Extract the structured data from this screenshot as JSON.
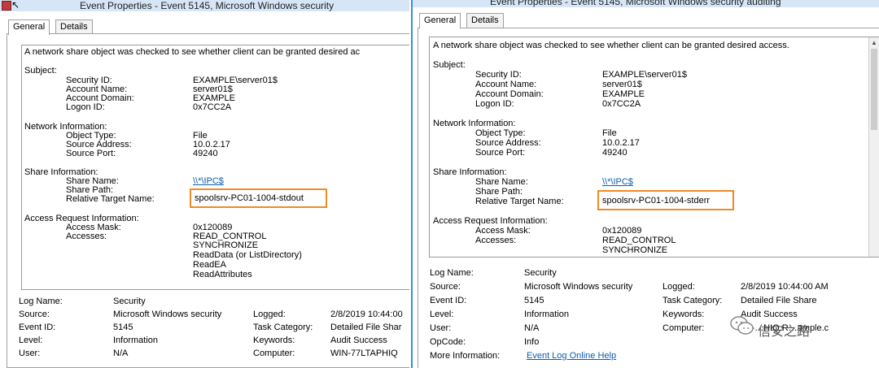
{
  "windows": [
    {
      "title": "Event Properties - Event 5145, Microsoft Windows security",
      "tabs": [
        "General",
        "Details"
      ],
      "description": {
        "summary": "A network share object was checked to see whether client can be granted desired ac",
        "subject_header": "Subject:",
        "security_id_label": "Security ID:",
        "security_id": "EXAMPLE\\server01$",
        "account_name_label": "Account Name:",
        "account_name": "server01$",
        "account_domain_label": "Account Domain:",
        "account_domain": "EXAMPLE",
        "logon_id_label": "Logon ID:",
        "logon_id": "0x7CC2A",
        "network_header": "Network Information:",
        "object_type_label": "Object Type:",
        "object_type": "File",
        "source_address_label": "Source Address:",
        "source_address": "10.0.2.17",
        "source_port_label": "Source Port:",
        "source_port": "49240",
        "share_header": "Share Information:",
        "share_name_label": "Share Name:",
        "share_name": "\\\\*\\IPC$",
        "share_path_label": "Share Path:",
        "relative_target_label": "Relative Target Name:",
        "relative_target": "spoolsrv-PC01-1004-stdout",
        "access_header": "Access Request Information:",
        "access_mask_label": "Access Mask:",
        "access_mask": "0x120089",
        "accesses_label": "Accesses:",
        "accesses": [
          "READ_CONTROL",
          "SYNCHRONIZE",
          "ReadData (or ListDirectory)",
          "ReadEA",
          "ReadAttributes"
        ]
      },
      "meta": {
        "log_name_label": "Log Name:",
        "log_name": "Security",
        "source_label": "Source:",
        "source": "Microsoft Windows security",
        "logged_label": "Logged:",
        "logged": "2/8/2019 10:44:00",
        "event_id_label": "Event ID:",
        "event_id": "5145",
        "task_category_label": "Task Category:",
        "task_category": "Detailed File Shar",
        "level_label": "Level:",
        "level": "Information",
        "keywords_label": "Keywords:",
        "keywords": "Audit Success",
        "user_label": "User:",
        "user": "N/A",
        "computer_label": "Computer:",
        "computer": "WIN-77LTAPHIQ"
      }
    },
    {
      "title": "Event Properties - Event 5145, Microsoft Windows security auditing",
      "tabs": [
        "General",
        "Details"
      ],
      "description": {
        "summary": "A network share object was checked to see whether client can be granted desired access.",
        "subject_header": "Subject:",
        "security_id_label": "Security ID:",
        "security_id": "EXAMPLE\\server01$",
        "account_name_label": "Account Name:",
        "account_name": "server01$",
        "account_domain_label": "Account Domain:",
        "account_domain": "EXAMPLE",
        "logon_id_label": "Logon ID:",
        "logon_id": "0x7CC2A",
        "network_header": "Network Information:",
        "object_type_label": "Object Type:",
        "object_type": "File",
        "source_address_label": "Source Address:",
        "source_address": "10.0.2.17",
        "source_port_label": "Source Port:",
        "source_port": "49240",
        "share_header": "Share Information:",
        "share_name_label": "Share Name:",
        "share_name": "\\\\*\\IPC$",
        "share_path_label": "Share Path:",
        "relative_target_label": "Relative Target Name:",
        "relative_target": "spoolsrv-PC01-1004-stderr",
        "access_header": "Access Request Information:",
        "access_mask_label": "Access Mask:",
        "access_mask": "0x120089",
        "accesses_label": "Accesses:",
        "accesses": [
          "READ_CONTROL",
          "SYNCHRONIZE"
        ]
      },
      "meta": {
        "log_name_label": "Log Name:",
        "log_name": "Security",
        "source_label": "Source:",
        "source": "Microsoft Windows security",
        "logged_label": "Logged:",
        "logged": "2/8/2019 10:44:00 AM",
        "event_id_label": "Event ID:",
        "event_id": "5145",
        "task_category_label": "Task Category:",
        "task_category": "Detailed File Share",
        "level_label": "Level:",
        "level": "Information",
        "keywords_label": "Keywords:",
        "keywords": "Audit Success",
        "user_label": "User:",
        "user": "N/A",
        "computer_label": "Computer:",
        "computer": "…l-…HIQ.R…ample.c",
        "opcode_label": "OpCode:",
        "opcode": "Info",
        "more_info_label": "More Information:",
        "more_info": "Event Log Online Help"
      }
    }
  ],
  "watermark": {
    "text": "信安之路"
  },
  "colors": {
    "highlight": "#f08a24",
    "link": "#0b5cad",
    "title_bar": "#d6e6f7"
  }
}
